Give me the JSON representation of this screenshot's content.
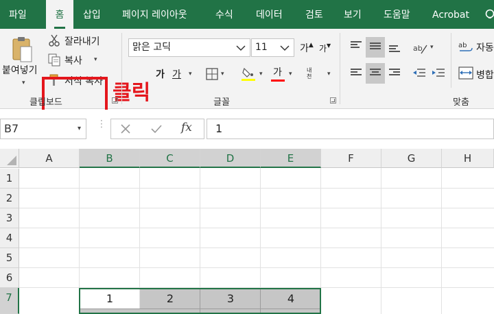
{
  "tabs": [
    "파일",
    "홈",
    "삽입",
    "페이지 레이아웃",
    "수식",
    "데이터",
    "검토",
    "보기",
    "도움말",
    "Acrobat"
  ],
  "active_tab": "홈",
  "clipboard": {
    "paste_label": "붙여넣기",
    "cut_label": "잘라내기",
    "copy_label": "복사",
    "format_painter_label": "서식 복사",
    "group_label": "클립보드"
  },
  "annotation": "클릭",
  "font": {
    "family": "맑은 고딕",
    "size": "11",
    "grow_glyph": "가",
    "shrink_glyph": "가",
    "bold": "가",
    "italic": "가",
    "underline": "가",
    "font_color_glyph": "가",
    "phonetic_glyph": "내천",
    "group_label": "글꼴"
  },
  "alignment": {
    "wrap_label": "자동",
    "merge_label": "병합",
    "group_label": "맞춤"
  },
  "formula_bar": {
    "name_box": "B7",
    "fx_label": "fx",
    "value": "1"
  },
  "grid": {
    "columns": [
      "A",
      "B",
      "C",
      "D",
      "E",
      "F",
      "G",
      "H"
    ],
    "rows": [
      "1",
      "2",
      "3",
      "4",
      "5",
      "6",
      "7"
    ],
    "row7_values": [
      "1",
      "2",
      "3",
      "4"
    ]
  },
  "colors": {
    "excel_green": "#217346",
    "highlight_red": "#e4161c",
    "fill_yellow": "#ffff00",
    "font_red": "#ff0000"
  }
}
